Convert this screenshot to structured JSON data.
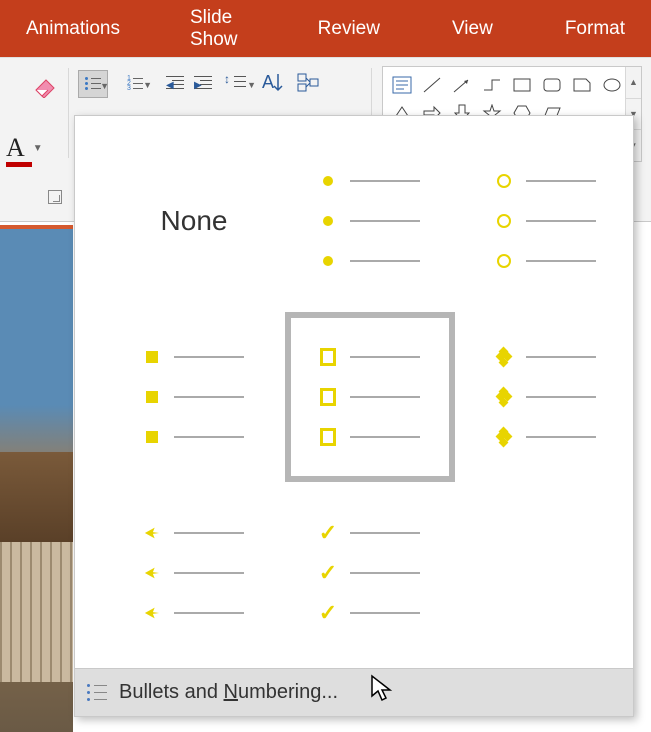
{
  "ribbon": {
    "tabs": [
      "Animations",
      "Slide Show",
      "Review",
      "View",
      "Format"
    ]
  },
  "toolbar": {
    "font_color_letter": "A"
  },
  "bullet_menu": {
    "none_label": "None",
    "footer_prefix": "Bullets and ",
    "footer_underlined": "N",
    "footer_suffix": "umbering...",
    "selected_index": 4,
    "options": [
      {
        "type": "none"
      },
      {
        "type": "dot"
      },
      {
        "type": "circle"
      },
      {
        "type": "square"
      },
      {
        "type": "square-outline"
      },
      {
        "type": "diamond4"
      },
      {
        "type": "arrow"
      },
      {
        "type": "check"
      },
      {
        "type": "blank"
      }
    ]
  }
}
